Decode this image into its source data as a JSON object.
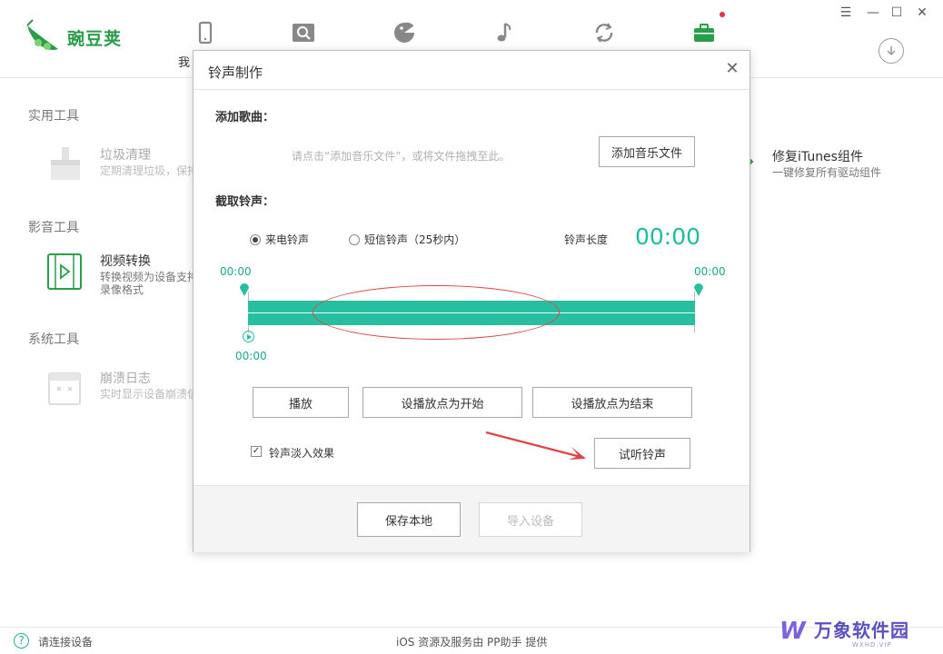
{
  "app": {
    "logo_text": "豌豆荚",
    "nav_label_partial": "我",
    "nav_icons": [
      "phone-icon",
      "search-icon",
      "pacman-icon",
      "music-icon",
      "sync-icon",
      "toolbox-icon"
    ],
    "window_controls": {
      "menu": "☰",
      "minimize": "—",
      "maximize": "☐",
      "close": "✕"
    },
    "download_icon": "download-icon"
  },
  "left": {
    "sections": [
      {
        "title": "实用工具"
      },
      {
        "title": "影音工具"
      },
      {
        "title": "系统工具"
      }
    ],
    "tools": [
      {
        "name": "垃圾清理",
        "desc": "定期清理垃圾，保持"
      },
      {
        "name": "视频转换",
        "desc": "转换视频为设备支持",
        "desc2": "录像格式"
      },
      {
        "name": "崩溃日志",
        "desc": "实时显示设备崩溃信"
      }
    ],
    "right_tool": {
      "name": "修复iTunes组件",
      "desc": "一键修复所有驱动组件"
    }
  },
  "dialog": {
    "title": "铃声制作",
    "close": "✕",
    "add_song_label": "添加歌曲：",
    "add_hint": "请点击“添加音乐文件”，或将文件拖拽至此。",
    "add_button": "添加音乐文件",
    "cut_label": "截取铃声：",
    "radio_incoming": "来电铃声",
    "radio_sms": "短信铃声（25秒内）",
    "length_label": "铃声长度",
    "length_value": "00:00",
    "start_time": "00:00",
    "end_time": "00:00",
    "play_time": "00:00",
    "btn_play": "播放",
    "btn_set_start": "设播放点为开始",
    "btn_set_end": "设播放点为结束",
    "fade_label": "铃声淡入效果",
    "fade_checked": "✓",
    "btn_preview": "试听铃声",
    "btn_save": "保存本地",
    "btn_import": "导入设备"
  },
  "footer": {
    "help": "?",
    "status": "请连接设备",
    "center": "iOS 资源及服务由 PP助手 提供"
  },
  "watermark": {
    "logo": "W",
    "text": "万象软件园",
    "sub": "WXHD.VIP"
  },
  "colors": {
    "accent": "#28bfa0",
    "brand": "#2a9d4a",
    "annotation": "#e04545"
  }
}
